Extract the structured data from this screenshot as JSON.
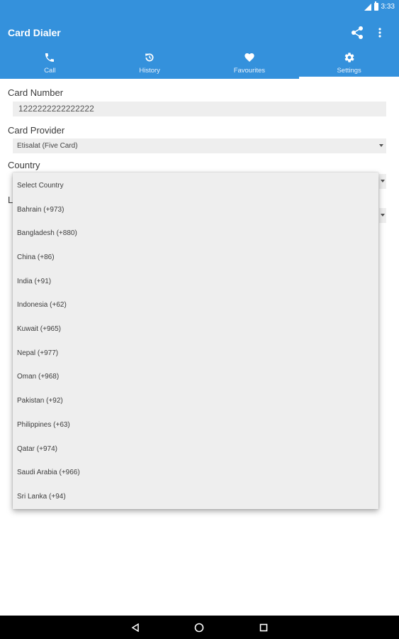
{
  "status_bar": {
    "time": "3:33"
  },
  "app_bar": {
    "title": "Card Dialer"
  },
  "tabs": [
    {
      "label": "Call",
      "icon": "phone-icon"
    },
    {
      "label": "History",
      "icon": "history-icon"
    },
    {
      "label": "Favourites",
      "icon": "heart-icon"
    },
    {
      "label": "Settings",
      "icon": "gear-icon",
      "active": true
    }
  ],
  "form": {
    "card_number_label": "Card Number",
    "card_number_value": "1222222222222222",
    "card_provider_label": "Card Provider",
    "card_provider_value": "Etisalat (Five Card)",
    "country_label": "Country",
    "hidden_label_initial": "L"
  },
  "country_dropdown": {
    "options": [
      "Select Country",
      "Bahrain (+973)",
      "Bangladesh (+880)",
      "China (+86)",
      "India (+91)",
      "Indonesia (+62)",
      "Kuwait (+965)",
      "Nepal (+977)",
      "Oman (+968)",
      "Pakistan (+92)",
      "Philippines (+63)",
      "Qatar (+974)",
      "Saudi Arabia (+966)",
      "Sri Lanka (+94)"
    ]
  },
  "colors": {
    "primary": "#3491dc",
    "field_bg": "#eeeeee"
  }
}
